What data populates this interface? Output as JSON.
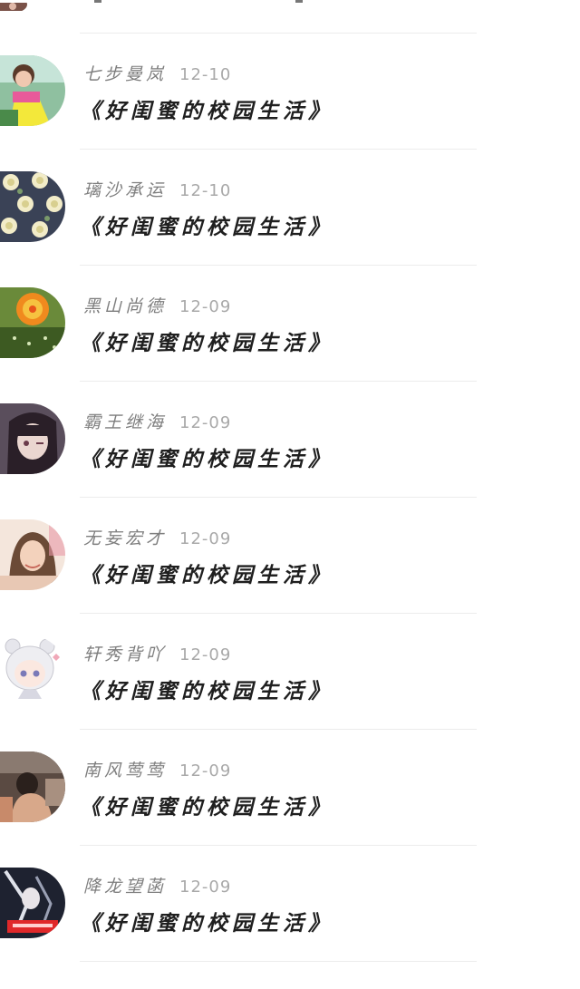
{
  "comments": [
    {
      "user": "七步曼岚",
      "date": "12-10",
      "work": "《好闺蜜的校园生活》",
      "avatar": "girl-photo-avatar"
    },
    {
      "user": "璃沙承运",
      "date": "12-10",
      "work": "《好闺蜜的校园生活》",
      "avatar": "floral-pattern-avatar"
    },
    {
      "user": "黑山尚德",
      "date": "12-09",
      "work": "《好闺蜜的校园生活》",
      "avatar": "cactus-flower-avatar"
    },
    {
      "user": "霸王继海",
      "date": "12-09",
      "work": "《好闺蜜的校园生活》",
      "avatar": "anime-girl-avatar"
    },
    {
      "user": "无妄宏才",
      "date": "12-09",
      "work": "《好闺蜜的校园生活》",
      "avatar": "woman-photo-avatar"
    },
    {
      "user": "轩秀背吖",
      "date": "12-09",
      "work": "《好闺蜜的校园生活》",
      "avatar": "chibi-bear-hood-avatar"
    },
    {
      "user": "南风莺莺",
      "date": "12-09",
      "work": "《好闺蜜的校园生活》",
      "avatar": "dim-room-photo-avatar"
    },
    {
      "user": "降龙望菡",
      "date": "12-09",
      "work": "《好闺蜜的校园生活》",
      "avatar": "dark-anime-avatar"
    }
  ]
}
